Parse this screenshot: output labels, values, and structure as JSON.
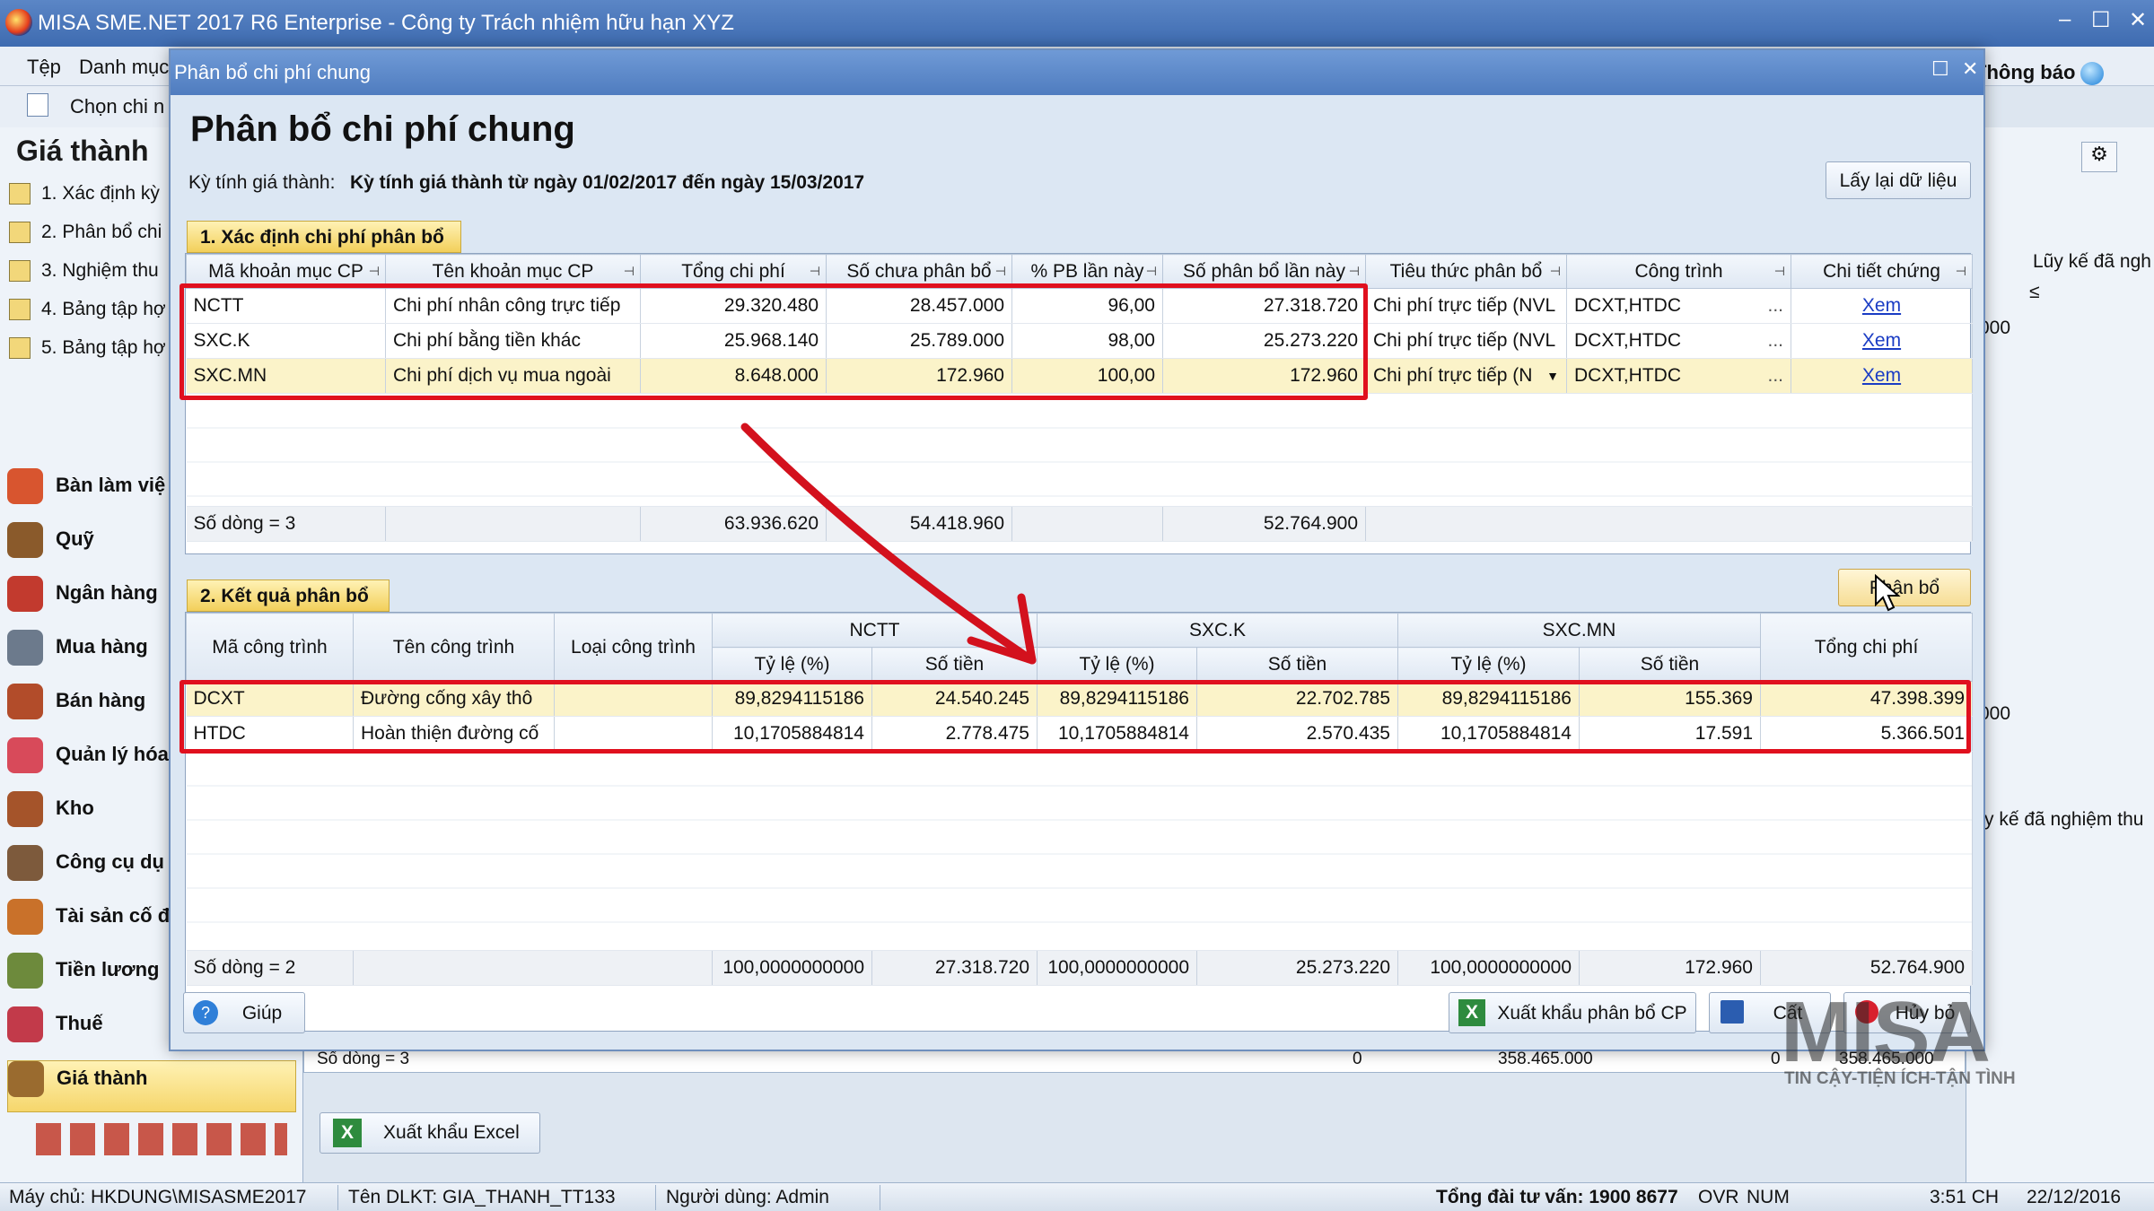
{
  "app": {
    "title": "MISA SME.NET 2017 R6 Enterprise - Công ty Trách nhiệm hữu hạn XYZ",
    "notifications": "Thông báo"
  },
  "menu": {
    "file": "Tệp",
    "catalog": "Danh mục",
    "choose": "Chọn chi n"
  },
  "left": {
    "title": "Giá thành",
    "steps": [
      "1. Xác định kỳ",
      "2. Phân bổ chi",
      "3. Nghiệm thu",
      "4. Bảng tập hợ",
      "5. Bảng tập hợ"
    ],
    "nav": [
      "Bàn làm việ",
      "Quỹ",
      "Ngân hàng",
      "Mua hàng",
      "Bán hàng",
      "Quản lý hóa",
      "Kho",
      "Công cụ dụ",
      "Tài sản cố đ",
      "Tiền lương",
      "Thuế",
      "Giá thành"
    ]
  },
  "bg": {
    "rowcount": "Số dòng = 3",
    "v1": "0",
    "v2": "358.465.000",
    "v3": "0",
    "v4": "358.465.000",
    "export_excel": "Xuất khẩu Excel",
    "col_luy_ke": "Lũy kế đã ngh",
    "col_luy_ke2": "y kế đã nghiệm thu",
    "val1": "000",
    "val2": "000",
    "le": "≤"
  },
  "dialog": {
    "window_title": "Phân bổ chi phí chung",
    "heading": "Phân bổ chi phí chung",
    "period_label": "Kỳ tính giá thành:",
    "period_value": "Kỳ tính giá thành từ ngày 01/02/2017 đến ngày 15/03/2017",
    "reload_button": "Lấy lại dữ liệu",
    "allocate_button": "Phân bổ",
    "section1": "1. Xác định chi phí phân bổ",
    "grid1": {
      "headers": [
        "Mã khoản mục CP",
        "Tên khoản mục CP",
        "Tổng chi phí",
        "Số chưa phân bổ",
        "% PB lần này",
        "Số phân bổ lần này",
        "Tiêu thức phân bổ",
        "Công trình",
        "Chi tiết chứng"
      ],
      "rows": [
        {
          "code": "NCTT",
          "name": "Chi phí nhân công trực tiếp",
          "total": "29.320.480",
          "unalloc": "28.457.000",
          "pct": "96,00",
          "alloc": "27.318.720",
          "basis": "Chi phí trực tiếp (NVL",
          "works": "DCXT,HTDC",
          "more": "...",
          "detail": "Xem"
        },
        {
          "code": "SXC.K",
          "name": "Chi phí bằng tiền khác",
          "total": "25.968.140",
          "unalloc": "25.789.000",
          "pct": "98,00",
          "alloc": "25.273.220",
          "basis": "Chi phí trực tiếp (NVL",
          "works": "DCXT,HTDC",
          "more": "...",
          "detail": "Xem"
        },
        {
          "code": "SXC.MN",
          "name": "Chi phí dịch vụ mua ngoài",
          "total": "8.648.000",
          "unalloc": "172.960",
          "pct": "100,00",
          "alloc": "172.960",
          "basis": "Chi phí trực tiếp (N",
          "works": "DCXT,HTDC",
          "more": "...",
          "detail": "Xem"
        }
      ],
      "footer": {
        "count": "Số dòng = 3",
        "total": "63.936.620",
        "unalloc": "54.418.960",
        "alloc": "52.764.900"
      }
    },
    "section2": "2. Kết quả phân bổ",
    "grid2": {
      "headers": {
        "code": "Mã công trình",
        "name": "Tên công trình",
        "type": "Loại công trình",
        "g1": "NCTT",
        "g2": "SXC.K",
        "g3": "SXC.MN",
        "rate": "Tỷ lệ (%)",
        "amount": "Số tiền",
        "total": "Tổng chi phí"
      },
      "rows": [
        {
          "code": "DCXT",
          "name": "Đường cống xây thô",
          "type": "",
          "r1": "89,8294115186",
          "a1": "24.540.245",
          "r2": "89,8294115186",
          "a2": "22.702.785",
          "r3": "89,8294115186",
          "a3": "155.369",
          "total": "47.398.399"
        },
        {
          "code": "HTDC",
          "name": "Hoàn thiện đường cố",
          "type": "",
          "r1": "10,1705884814",
          "a1": "2.778.475",
          "r2": "10,1705884814",
          "a2": "2.570.435",
          "r3": "10,1705884814",
          "a3": "17.591",
          "total": "5.366.501"
        }
      ],
      "footer": {
        "count": "Số dòng = 2",
        "r1": "100,0000000000",
        "a1": "27.318.720",
        "r2": "100,0000000000",
        "a2": "25.273.220",
        "r3": "100,0000000000",
        "a3": "172.960",
        "total": "52.764.900"
      }
    },
    "help_button": "Giúp",
    "export_button": "Xuất khẩu phân bổ CP",
    "save_button": "Cất",
    "cancel_button": "Hủy bỏ"
  },
  "status": {
    "server": "Máy chủ: HKDUNG\\MISASME2017",
    "db": "Tên DLKT: GIA_THANH_TT133",
    "user": "Người dùng: Admin",
    "hotline": "Tổng đài tư vấn: 1900 8677",
    "ovr": "OVR",
    "num": "NUM",
    "time": "3:51 CH",
    "date": "22/12/2016"
  },
  "watermark": {
    "brand": "MISA",
    "tagline": "TIN CẬY-TIỆN ÍCH-TẬN TÌNH"
  },
  "colors": {
    "highlight_red": "#e0101e",
    "section_yellow": "#f2cf5a",
    "title_blue": "#4f7cbf"
  }
}
